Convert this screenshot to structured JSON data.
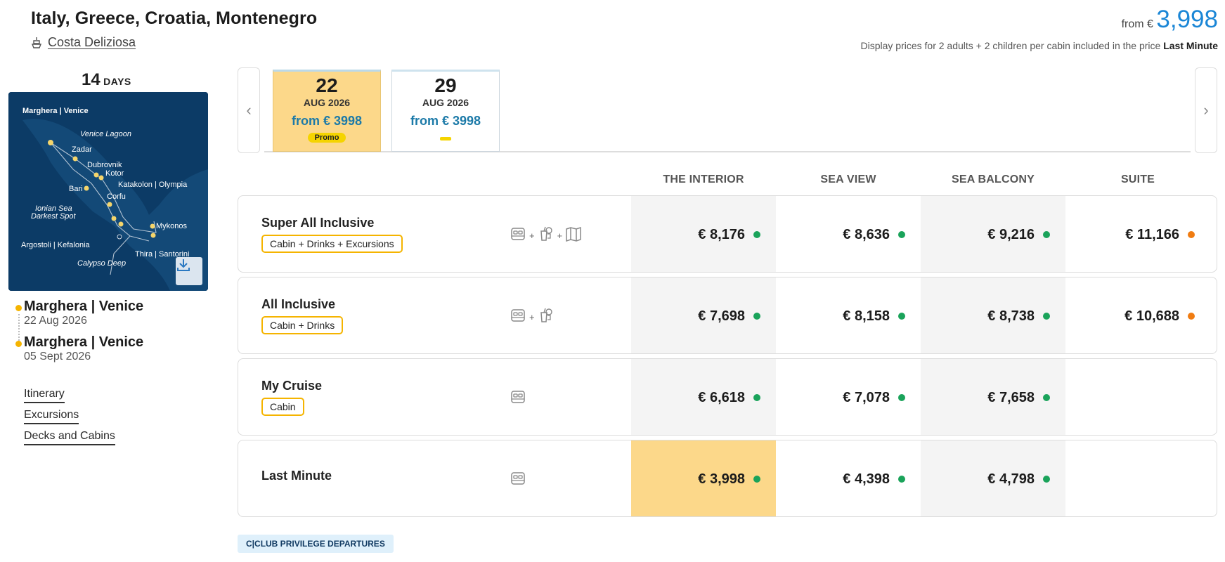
{
  "header": {
    "title": "Italy, Greece, Croatia, Montenegro",
    "ship": "Costa Deliziosa",
    "from_label": "from €",
    "from_value": "3,998",
    "display_note": "Display prices for 2 adults + 2 children per cabin included in the price",
    "display_note_bold": "Last Minute"
  },
  "duration": {
    "number": "14",
    "unit": "DAYS"
  },
  "map": {
    "labels": [
      "Marghera | Venice",
      "Venice Lagoon",
      "Zadar",
      "Dubrovnik",
      "Kotor",
      "Bari",
      "Katakolon | Olympia",
      "Corfu",
      "Ionian Sea",
      "Darkest Spot",
      "Mykonos",
      "Argostoli | Kefalonia",
      "Thira | Santorini",
      "Calypso Deep"
    ]
  },
  "ports": [
    {
      "name": "Marghera | Venice",
      "date": "22 Aug 2026"
    },
    {
      "name": "Marghera | Venice",
      "date": "05 Sept 2026"
    }
  ],
  "links": [
    "Itinerary",
    "Excursions",
    "Decks and Cabins"
  ],
  "dates": [
    {
      "day": "22",
      "month": "AUG 2026",
      "price": "from € 3998",
      "badge": "Promo"
    },
    {
      "day": "29",
      "month": "AUG 2026",
      "price": "from € 3998"
    }
  ],
  "columns": [
    "THE INTERIOR",
    "SEA VIEW",
    "SEA BALCONY",
    "SUITE"
  ],
  "colors": {
    "available": "#1aa35a",
    "limited": "#f07c12",
    "accent": "#f5b400",
    "highlight": "#fcd88a",
    "link": "#1a86d6"
  },
  "packages": [
    {
      "name": "Super All Inclusive",
      "tag": "Cabin + Drinks + Excursions",
      "icons": [
        "bed-icon",
        "drink-icon",
        "map-icon"
      ],
      "prices": [
        "€ 8,176",
        "€ 8,636",
        "€ 9,216",
        "€ 11,166"
      ],
      "status": [
        "available",
        "available",
        "available",
        "limited"
      ]
    },
    {
      "name": "All Inclusive",
      "tag": "Cabin + Drinks",
      "icons": [
        "bed-icon",
        "drink-icon"
      ],
      "prices": [
        "€ 7,698",
        "€ 8,158",
        "€ 8,738",
        "€ 10,688"
      ],
      "status": [
        "available",
        "available",
        "available",
        "limited"
      ]
    },
    {
      "name": "My Cruise",
      "tag": "Cabin",
      "icons": [
        "bed-icon"
      ],
      "prices": [
        "€ 6,618",
        "€ 7,078",
        "€ 7,658",
        ""
      ],
      "status": [
        "available",
        "available",
        "available",
        ""
      ]
    },
    {
      "name": "Last Minute",
      "tag": "",
      "icons": [
        "bed-icon"
      ],
      "prices": [
        "€ 3,998",
        "€ 4,398",
        "€ 4,798",
        ""
      ],
      "status": [
        "available",
        "available",
        "available",
        ""
      ]
    }
  ],
  "club_button": "C|CLUB PRIVILEGE DEPARTURES"
}
